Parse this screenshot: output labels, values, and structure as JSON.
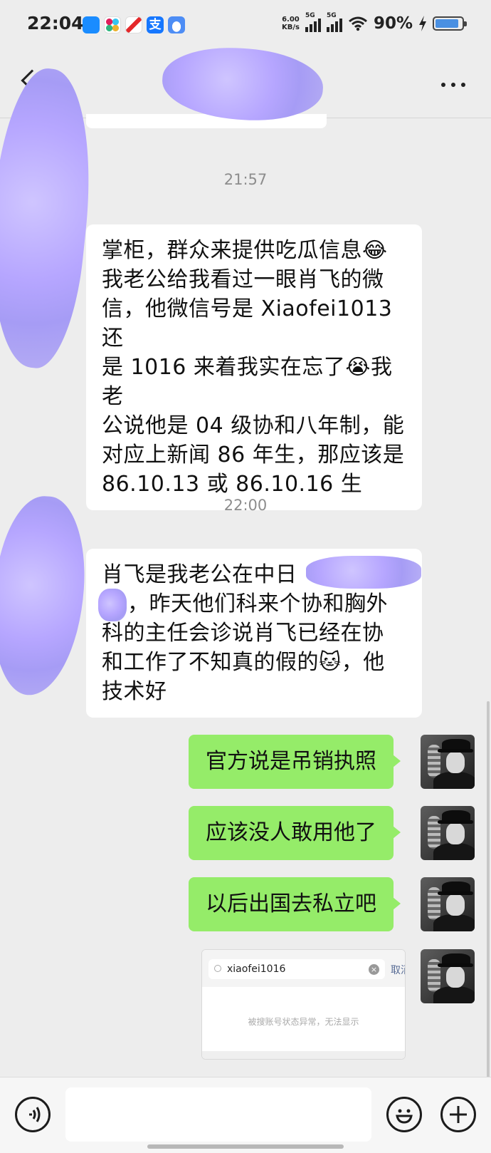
{
  "status_bar": {
    "time": "22:04",
    "net_speed_value": "6.00",
    "net_speed_unit": "KB/s",
    "signal1_label": "5G",
    "signal2_label": "5G",
    "battery_percent": "90%",
    "battery_level": 0.9,
    "app_icons": [
      "ele-me-icon",
      "slack-icon",
      "mail-icon",
      "alipay-icon",
      "weather-icon"
    ]
  },
  "nav": {
    "back_icon": "chevron-left-icon",
    "more_icon": "more-dots-icon"
  },
  "messages": [
    {
      "time": "21:57",
      "direction": "in",
      "lines": [
        "掌柜，群众来提供吃瓜信息😂",
        "我老公给我看过一眼肖飞的微",
        "信，他微信号是 Xiaofei1013 还",
        "是 1016 来着我实在忘了😭我老",
        "公说他是 04 级协和八年制，能",
        "对应上新闻 86 年生，那应该是",
        "86.10.13 或 86.10.16 生"
      ]
    },
    {
      "time": "22:00",
      "direction": "in",
      "lines": [
        "肖飞是我老公在中日",
        "，昨天他们科来个协和胸外",
        "科的主任会诊说肖飞已经在协",
        "和工作了不知真的假的🐱，他",
        "技术好"
      ]
    },
    {
      "direction": "out",
      "text": "官方说是吊销执照"
    },
    {
      "direction": "out",
      "text": "应该没人敢用他了"
    },
    {
      "direction": "out",
      "text": "以后出国去私立吧"
    }
  ],
  "image_message": {
    "search_value": "xiaofei1016",
    "cancel_label": "取消",
    "notice": "被搜账号状态异常，无法显示"
  },
  "input_bar": {
    "voice_icon": "voice-icon",
    "emoji_icon": "emoji-icon",
    "plus_icon": "plus-icon"
  },
  "colors": {
    "background": "#ededed",
    "outgoing_bubble": "#95ec69",
    "incoming_bubble": "#ffffff",
    "timestamp": "#8d8d8d",
    "link_blue": "#576b95"
  }
}
